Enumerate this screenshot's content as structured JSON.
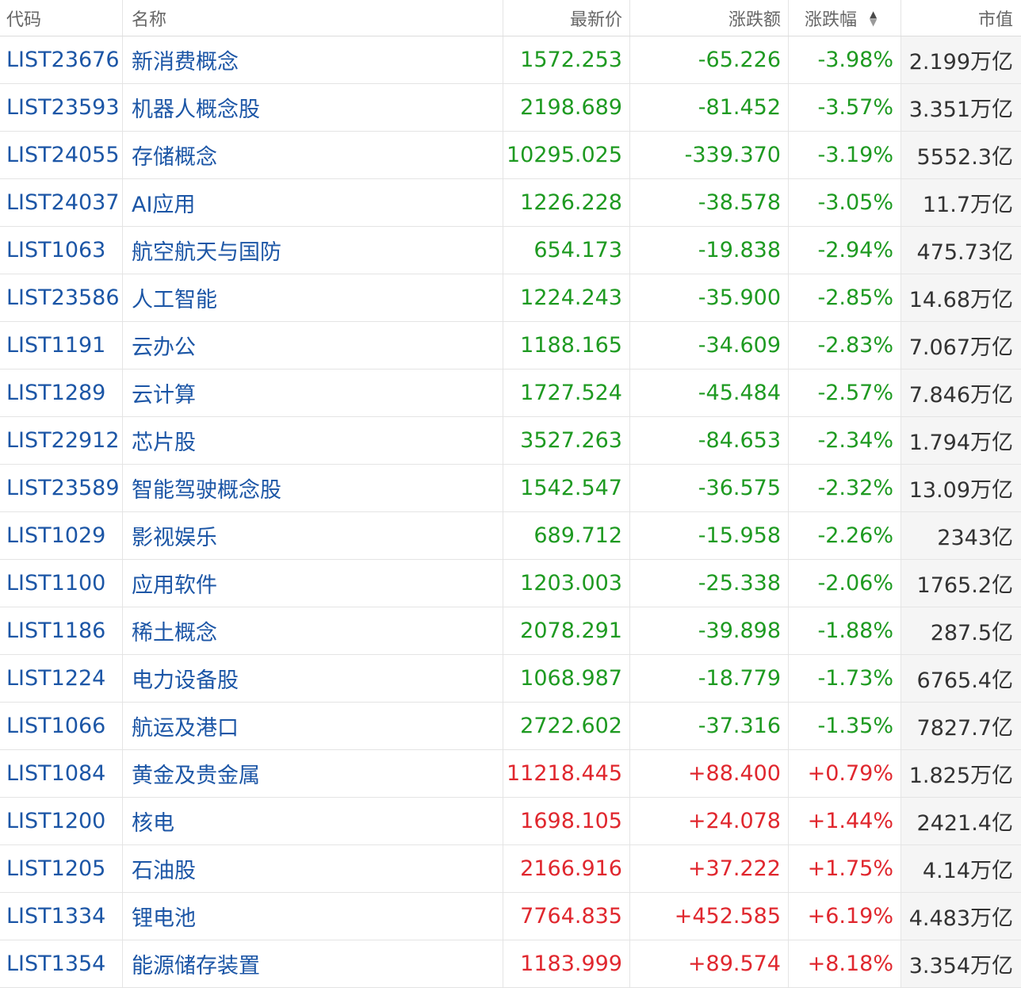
{
  "header": {
    "code": "代码",
    "name": "名称",
    "price": "最新价",
    "change": "涨跌额",
    "pct": "涨跌幅",
    "mcap": "市值",
    "sort_up_glyph": "▲",
    "sort_down_glyph": "▼"
  },
  "colors": {
    "down": "#1e9a21",
    "up": "#e0272e",
    "link": "#1c56a6"
  },
  "rows": [
    {
      "code": "LIST23676",
      "name": "新消费概念",
      "price": "1572.253",
      "change": "-65.226",
      "pct": "-3.98%",
      "mcap": "2.199万亿",
      "dir": "down"
    },
    {
      "code": "LIST23593",
      "name": "机器人概念股",
      "price": "2198.689",
      "change": "-81.452",
      "pct": "-3.57%",
      "mcap": "3.351万亿",
      "dir": "down"
    },
    {
      "code": "LIST24055",
      "name": "存储概念",
      "price": "10295.025",
      "change": "-339.370",
      "pct": "-3.19%",
      "mcap": "5552.3亿",
      "dir": "down"
    },
    {
      "code": "LIST24037",
      "name": "AI应用",
      "price": "1226.228",
      "change": "-38.578",
      "pct": "-3.05%",
      "mcap": "11.7万亿",
      "dir": "down"
    },
    {
      "code": "LIST1063",
      "name": "航空航天与国防",
      "price": "654.173",
      "change": "-19.838",
      "pct": "-2.94%",
      "mcap": "475.73亿",
      "dir": "down"
    },
    {
      "code": "LIST23586",
      "name": "人工智能",
      "price": "1224.243",
      "change": "-35.900",
      "pct": "-2.85%",
      "mcap": "14.68万亿",
      "dir": "down"
    },
    {
      "code": "LIST1191",
      "name": "云办公",
      "price": "1188.165",
      "change": "-34.609",
      "pct": "-2.83%",
      "mcap": "7.067万亿",
      "dir": "down"
    },
    {
      "code": "LIST1289",
      "name": "云计算",
      "price": "1727.524",
      "change": "-45.484",
      "pct": "-2.57%",
      "mcap": "7.846万亿",
      "dir": "down"
    },
    {
      "code": "LIST22912",
      "name": "芯片股",
      "price": "3527.263",
      "change": "-84.653",
      "pct": "-2.34%",
      "mcap": "1.794万亿",
      "dir": "down"
    },
    {
      "code": "LIST23589",
      "name": "智能驾驶概念股",
      "price": "1542.547",
      "change": "-36.575",
      "pct": "-2.32%",
      "mcap": "13.09万亿",
      "dir": "down"
    },
    {
      "code": "LIST1029",
      "name": "影视娱乐",
      "price": "689.712",
      "change": "-15.958",
      "pct": "-2.26%",
      "mcap": "2343亿",
      "dir": "down"
    },
    {
      "code": "LIST1100",
      "name": "应用软件",
      "price": "1203.003",
      "change": "-25.338",
      "pct": "-2.06%",
      "mcap": "1765.2亿",
      "dir": "down"
    },
    {
      "code": "LIST1186",
      "name": "稀土概念",
      "price": "2078.291",
      "change": "-39.898",
      "pct": "-1.88%",
      "mcap": "287.5亿",
      "dir": "down"
    },
    {
      "code": "LIST1224",
      "name": "电力设备股",
      "price": "1068.987",
      "change": "-18.779",
      "pct": "-1.73%",
      "mcap": "6765.4亿",
      "dir": "down"
    },
    {
      "code": "LIST1066",
      "name": "航运及港口",
      "price": "2722.602",
      "change": "-37.316",
      "pct": "-1.35%",
      "mcap": "7827.7亿",
      "dir": "down"
    },
    {
      "code": "LIST1084",
      "name": "黄金及贵金属",
      "price": "11218.445",
      "change": "+88.400",
      "pct": "+0.79%",
      "mcap": "1.825万亿",
      "dir": "up"
    },
    {
      "code": "LIST1200",
      "name": "核电",
      "price": "1698.105",
      "change": "+24.078",
      "pct": "+1.44%",
      "mcap": "2421.4亿",
      "dir": "up"
    },
    {
      "code": "LIST1205",
      "name": "石油股",
      "price": "2166.916",
      "change": "+37.222",
      "pct": "+1.75%",
      "mcap": "4.14万亿",
      "dir": "up"
    },
    {
      "code": "LIST1334",
      "name": "锂电池",
      "price": "7764.835",
      "change": "+452.585",
      "pct": "+6.19%",
      "mcap": "4.483万亿",
      "dir": "up"
    },
    {
      "code": "LIST1354",
      "name": "能源储存装置",
      "price": "1183.999",
      "change": "+89.574",
      "pct": "+8.18%",
      "mcap": "3.354万亿",
      "dir": "up"
    }
  ]
}
